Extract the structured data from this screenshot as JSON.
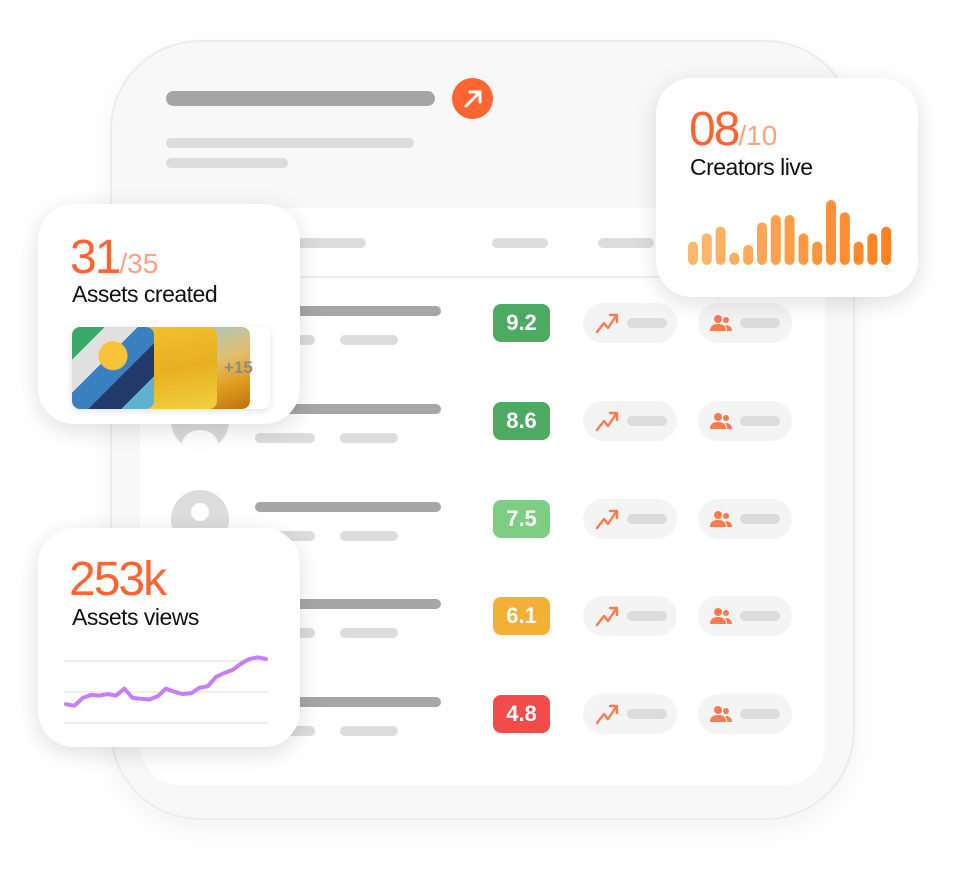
{
  "colors": {
    "accent": "#ff6433",
    "accent_light": "#ffa184",
    "green_dark": "#4daa63",
    "green_light": "#7dcd82",
    "amber": "#f2b136",
    "red": "#f24b4b",
    "line": "#c77dff"
  },
  "header": {
    "icon": "arrow-up-right-icon"
  },
  "rows": [
    {
      "score": "9.2",
      "color": "#4daa63"
    },
    {
      "score": "8.6",
      "color": "#4daa63"
    },
    {
      "score": "7.5",
      "color": "#7dcd82"
    },
    {
      "score": "6.1",
      "color": "#f2b136"
    },
    {
      "score": "4.8",
      "color": "#f24b4b"
    }
  ],
  "creators_card": {
    "value": "08",
    "total": "/10",
    "label": "Creators live",
    "bars": [
      70,
      95,
      115,
      37,
      60,
      128,
      150,
      150,
      95,
      70,
      195,
      158,
      70,
      95,
      115
    ]
  },
  "assets_card": {
    "value": "31",
    "total": "/35",
    "label": "Assets created",
    "more": "+15"
  },
  "views_card": {
    "value": "253k",
    "label": "Assets views",
    "series": [
      10,
      8,
      18,
      22,
      21,
      23,
      21,
      30,
      18,
      17,
      16,
      20,
      30,
      26,
      23,
      24,
      31,
      33,
      45,
      50,
      54,
      62,
      68,
      70,
      68
    ]
  }
}
